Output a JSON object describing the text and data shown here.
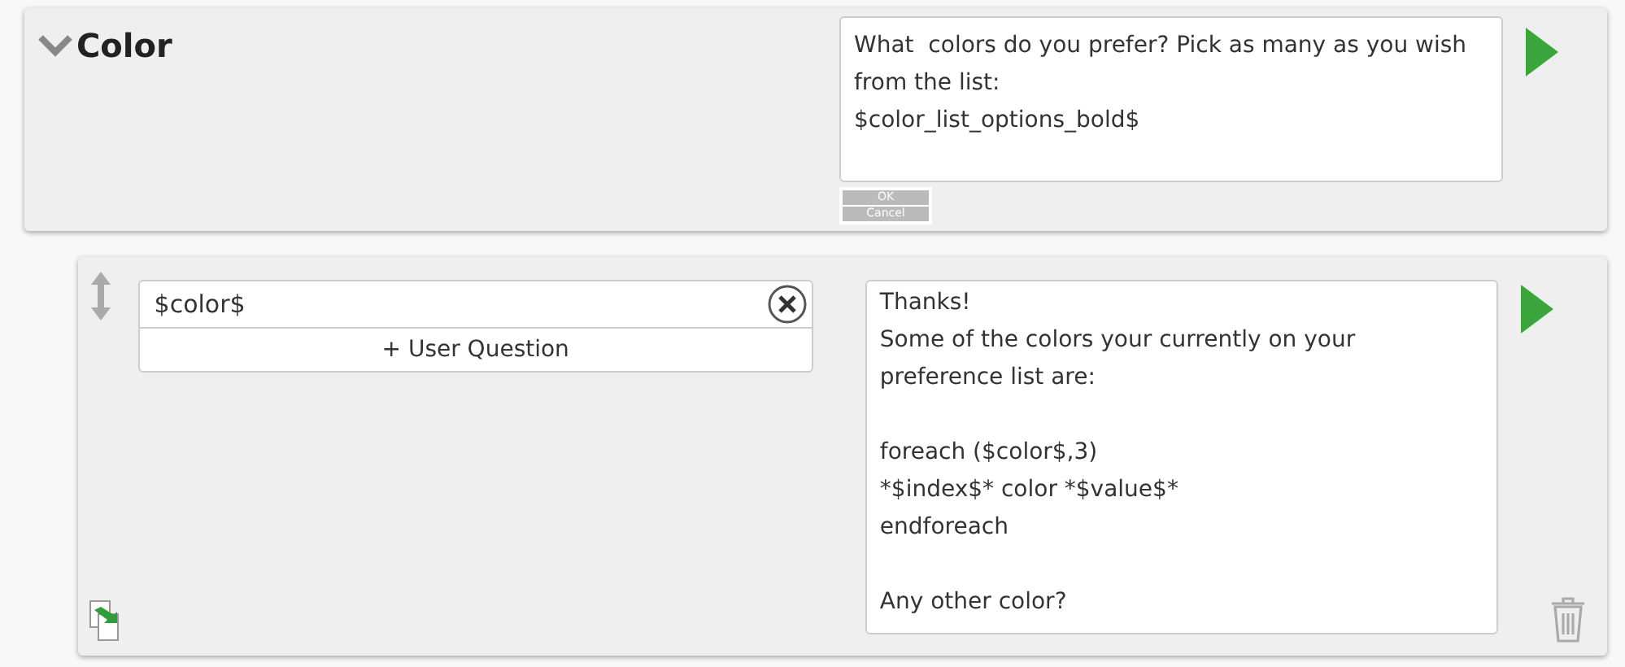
{
  "question_block": {
    "title": "Color",
    "expanded": true,
    "prompt": "What  colors do you prefer? Pick as many as you wish from the list:\n$color_list_options_bold$",
    "buttons": [
      "OK",
      "Cancel"
    ]
  },
  "answer_block": {
    "variable": "$color$",
    "add_label": "+ User Question",
    "response": "Thanks!\nSome of the colors your currently on your preference list are:\n\nforeach ($color$,3)\n*$index$* color *$value$*\nendforeach\n\nAny other color?"
  }
}
